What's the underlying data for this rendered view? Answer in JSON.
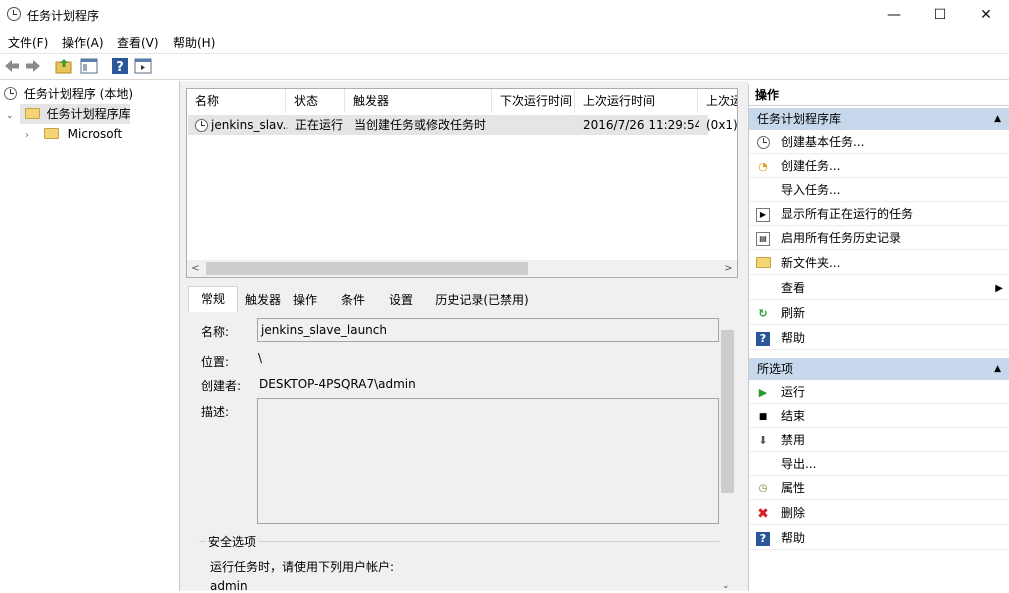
{
  "window": {
    "title": "任务计划程序",
    "minimize_glyph": "—",
    "maximize_glyph": "☐",
    "close_glyph": "✕"
  },
  "menu": [
    "文件(F)",
    "操作(A)",
    "查看(V)",
    "帮助(H)"
  ],
  "tree": {
    "root": "任务计划程序 (本地)",
    "library": "任务计划程序库",
    "child": "Microsoft"
  },
  "task_list": {
    "columns": [
      "名称",
      "状态",
      "触发器",
      "下次运行时间",
      "上次运行时间",
      "上次运"
    ],
    "rows": [
      {
        "name": "jenkins_slav...",
        "status": "正在运行",
        "trigger": "当创建任务或修改任务时",
        "next_run": "",
        "last_run": "2016/7/26 11:29:54",
        "last_result": "(0x1)"
      }
    ]
  },
  "tabs": [
    "常规",
    "触发器",
    "操作",
    "条件",
    "设置",
    "历史记录(已禁用)"
  ],
  "general": {
    "name_label": "名称:",
    "name_value": "jenkins_slave_launch",
    "location_label": "位置:",
    "location_value": "\\",
    "author_label": "创建者:",
    "author_value": "DESKTOP-4PSQRA7\\admin",
    "description_label": "描述:",
    "description_value": "",
    "security_title": "安全选项",
    "run_as_label": "运行任务时，请使用下列用户帐户:",
    "run_as_value": "admin"
  },
  "actions_panel": {
    "header": "操作",
    "library_section": {
      "title": "任务计划程序库",
      "items": [
        {
          "label": "创建基本任务...",
          "icon": "create-basic-task-icon"
        },
        {
          "label": "创建任务...",
          "icon": "create-task-icon"
        },
        {
          "label": "导入任务...",
          "icon": ""
        },
        {
          "label": "显示所有正在运行的任务",
          "icon": "running-tasks-icon"
        },
        {
          "label": "启用所有任务历史记录",
          "icon": "history-icon"
        },
        {
          "label": "新文件夹...",
          "icon": "folder-icon"
        },
        {
          "label": "查看",
          "icon": ""
        },
        {
          "label": "刷新",
          "icon": "refresh-icon"
        },
        {
          "label": "帮助",
          "icon": "help-icon"
        }
      ]
    },
    "selected_section": {
      "title": "所选项",
      "items": [
        {
          "label": "运行",
          "icon": "run-icon"
        },
        {
          "label": "结束",
          "icon": "stop-icon"
        },
        {
          "label": "禁用",
          "icon": "disable-icon"
        },
        {
          "label": "导出...",
          "icon": ""
        },
        {
          "label": "属性",
          "icon": "properties-icon"
        },
        {
          "label": "删除",
          "icon": "delete-icon"
        },
        {
          "label": "帮助",
          "icon": "help-icon"
        }
      ]
    }
  },
  "colors": {
    "section_header_bg": "#c8d8ec",
    "selected_row_bg": "#e5e5e5",
    "panel_bg": "#f0f0f0",
    "run_green": "#2a9d2a",
    "delete_red": "#d42020",
    "help_blue": "#2b579a"
  }
}
